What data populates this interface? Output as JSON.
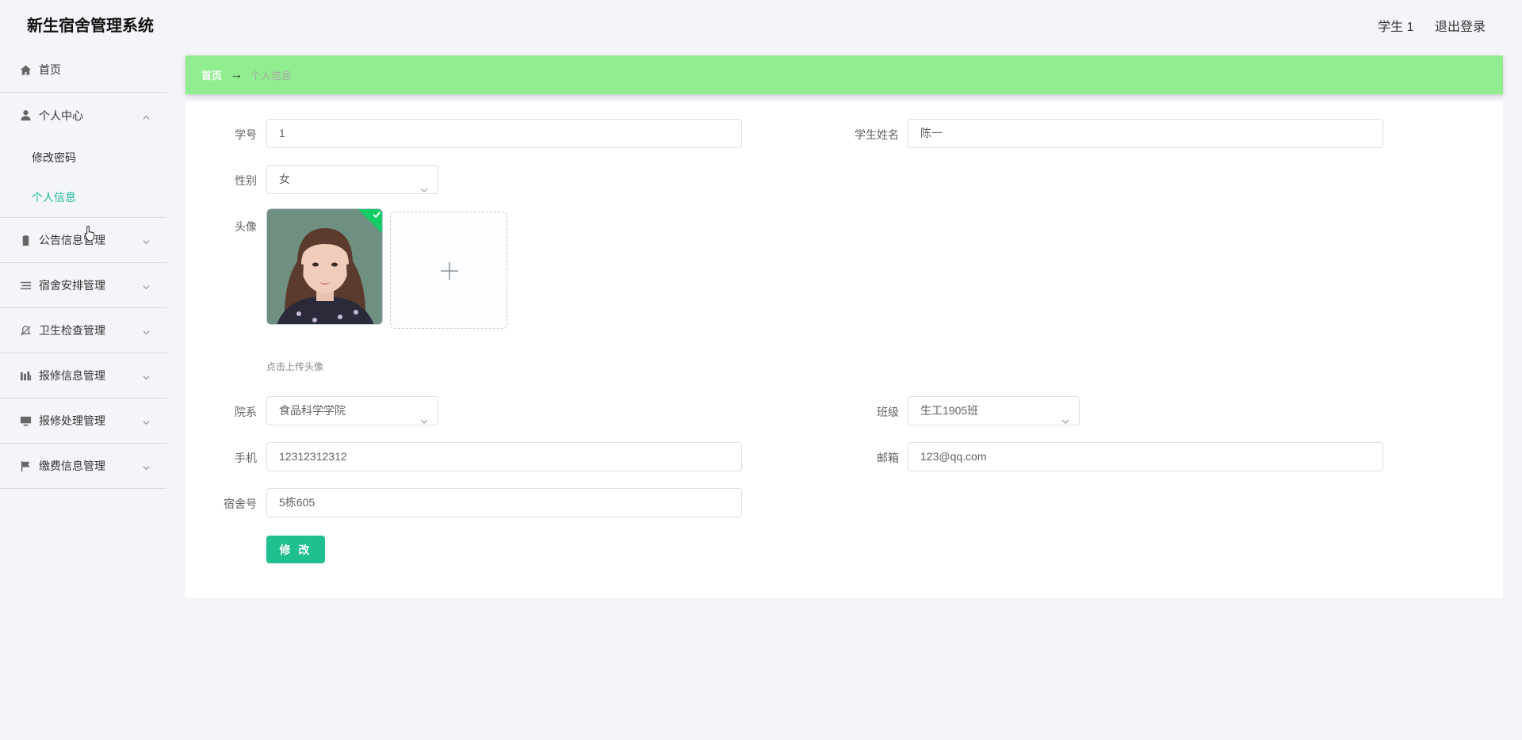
{
  "app": {
    "title": "新生宿舍管理系统"
  },
  "header": {
    "user": "学生 1",
    "logout": "退出登录"
  },
  "sidebar": {
    "home": "首页",
    "personal_center": {
      "label": "个人中心",
      "items": [
        "修改密码",
        "个人信息"
      ]
    },
    "menus": [
      "公告信息管理",
      "宿舍安排管理",
      "卫生检查管理",
      "报修信息管理",
      "报修处理管理",
      "缴费信息管理"
    ]
  },
  "breadcrumb": {
    "home": "首页",
    "separator": "→",
    "current": "个人信息"
  },
  "form": {
    "student_no": {
      "label": "学号",
      "value": "1"
    },
    "student_name": {
      "label": "学生姓名",
      "value": "陈一"
    },
    "gender": {
      "label": "性别",
      "value": "女"
    },
    "avatar": {
      "label": "头像",
      "tip": "点击上传头像"
    },
    "department": {
      "label": "院系",
      "value": "食品科学学院"
    },
    "class": {
      "label": "班级",
      "value": "生工1905班"
    },
    "phone": {
      "label": "手机",
      "value": "12312312312"
    },
    "email": {
      "label": "邮箱",
      "value": "123@qq.com"
    },
    "dorm": {
      "label": "宿舍号",
      "value": "5栋605"
    },
    "submit_label": "修 改"
  },
  "colors": {
    "accent": "#1fb99a",
    "breadcrumb_bg": "#90ee90",
    "button": "#1fbf8f",
    "upload_check": "#13ce66"
  },
  "icons": [
    "home-icon",
    "user-icon",
    "clipboard-icon",
    "list-icon",
    "no-bell-icon",
    "chart-bars-icon",
    "monitor-icon",
    "flag-icon",
    "chevron-down-icon",
    "chevron-up-icon",
    "plus-icon",
    "check-icon"
  ]
}
